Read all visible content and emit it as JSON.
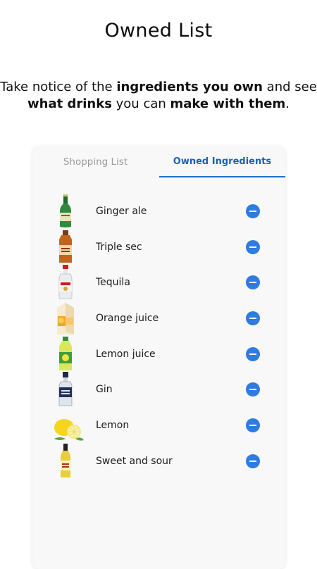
{
  "header": {
    "title": "Owned List",
    "subtitle": {
      "p1": "Take notice of the ",
      "b1": "ingredients you own",
      "p2": " and see ",
      "b2": "what drinks",
      "p3": " you can ",
      "b3": "make with them",
      "p4": "."
    }
  },
  "tabs": {
    "shopping": "Shopping List",
    "owned": "Owned Ingredients",
    "active_color": "#1d5fb8"
  },
  "ingredients": [
    {
      "name": "Ginger ale",
      "icon": "green-bottle-icon"
    },
    {
      "name": "Triple sec",
      "icon": "liqueur-bottle-icon"
    },
    {
      "name": "Tequila",
      "icon": "tequila-bottle-icon"
    },
    {
      "name": "Orange juice",
      "icon": "juice-carton-icon"
    },
    {
      "name": "Lemon juice",
      "icon": "lemon-juice-bottle-icon"
    },
    {
      "name": "Gin",
      "icon": "gin-bottle-icon"
    },
    {
      "name": "Lemon",
      "icon": "lemon-icon"
    },
    {
      "name": "Sweet and sour",
      "icon": "mixer-bottle-icon"
    }
  ],
  "remove_button_color": "#2f7be0"
}
